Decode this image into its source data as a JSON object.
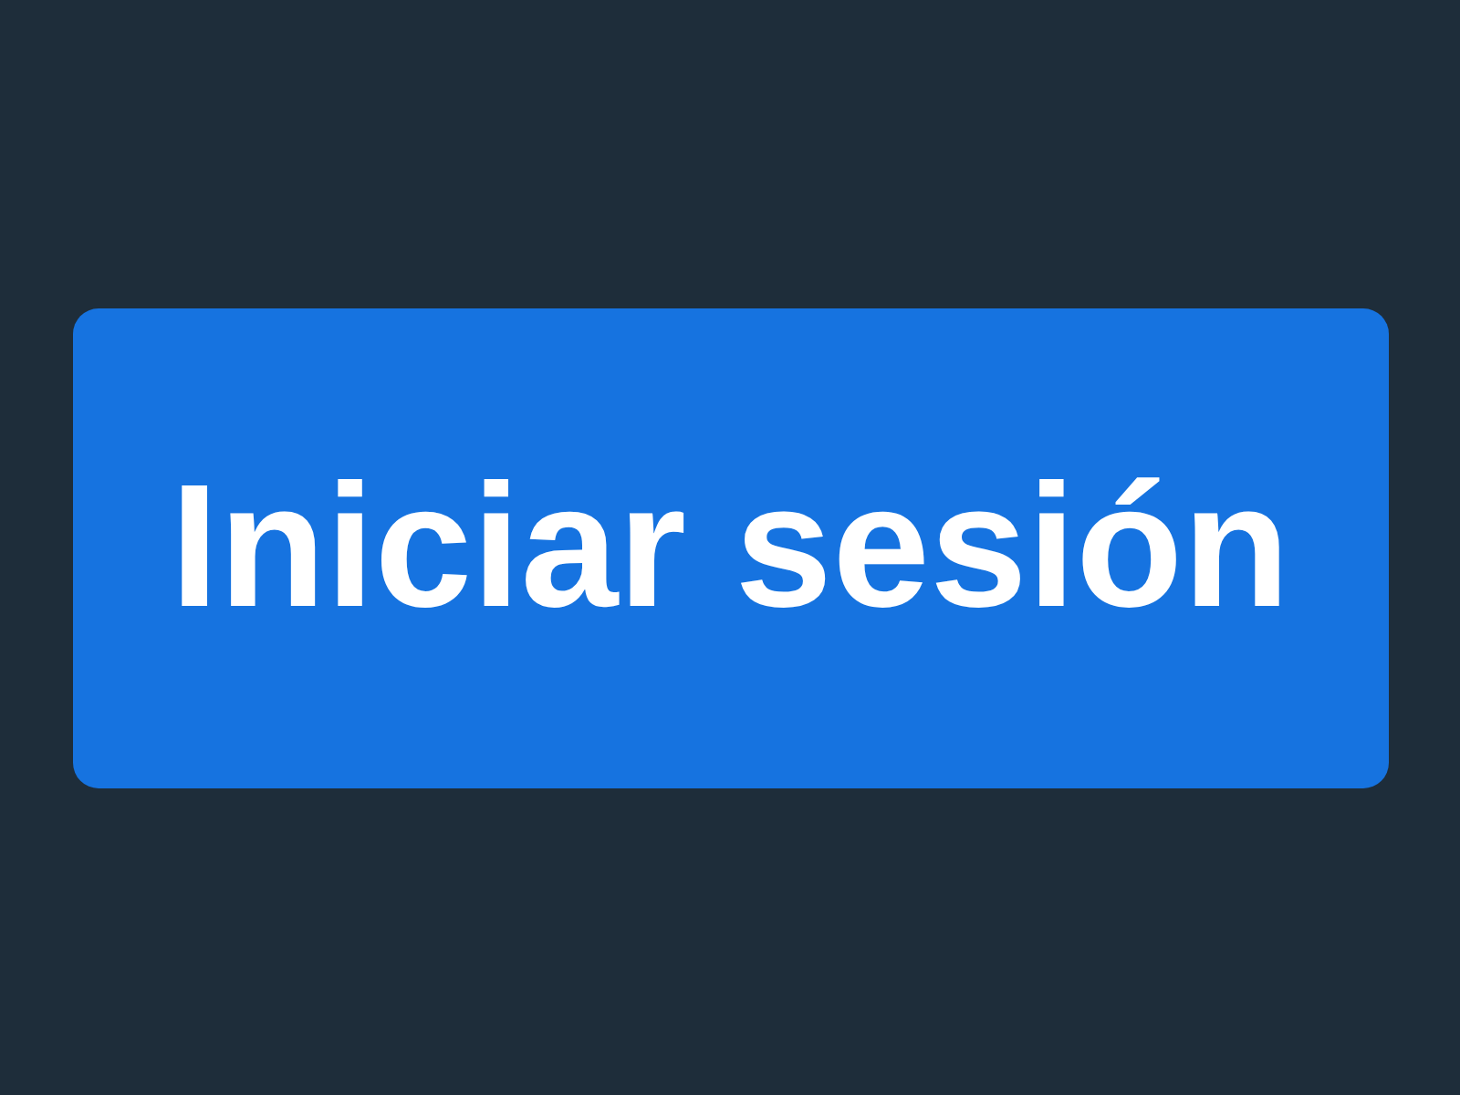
{
  "button": {
    "label": "Iniciar sesión"
  }
}
